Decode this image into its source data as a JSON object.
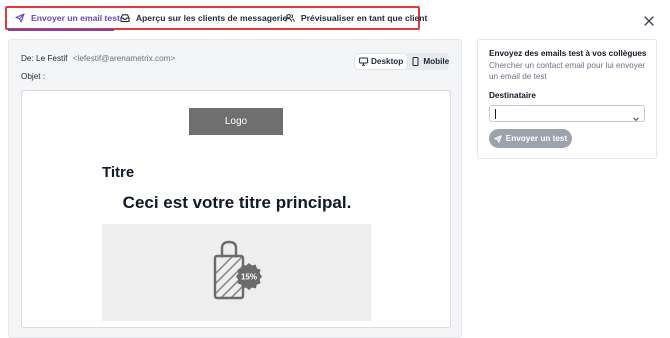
{
  "tabs": {
    "send_test": "Envoyer un email test",
    "client_preview": "Aperçu sur les clients de messagerie",
    "personalize_preview": "Prévisualiser en tant que client"
  },
  "header": {
    "from_label": "De:",
    "from_name": "Le Festif",
    "from_email": "<lefestif@arenametrix.com>",
    "subject_label": "Objet :"
  },
  "devices": {
    "desktop": "Desktop",
    "mobile": "Mobile",
    "active": "desktop"
  },
  "email": {
    "logo": "Logo",
    "title": "Titre",
    "headline": "Ceci est votre titre principal.",
    "badge": "15%"
  },
  "side": {
    "title": "Envoyez des emails test à vos collègues",
    "description": "Chercher un contact email pour lui envoyer un email de test",
    "recipient_label": "Destinataire",
    "recipient_value": "",
    "send_button": "Envoyer un test"
  },
  "colors": {
    "accent": "#6b46c1",
    "highlight_border": "#e23a3a",
    "button_disabled": "#9ca3af",
    "logo_bg": "#6f6f6f"
  }
}
